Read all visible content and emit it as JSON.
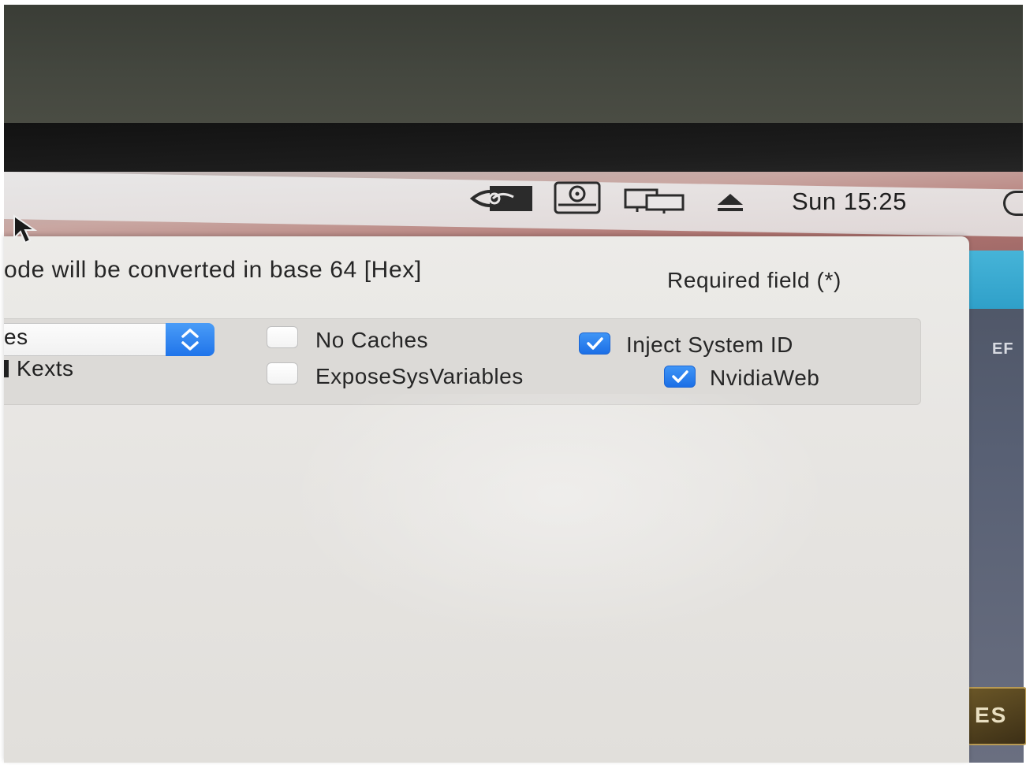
{
  "menubar": {
    "clock": "Sun 15:25",
    "icons": [
      "nvidia-icon",
      "disk-icon",
      "displays-icon",
      "eject-icon"
    ]
  },
  "dialog": {
    "info_text": "ode will be converted in base 64 [Hex]",
    "required_text": "Required field (*)",
    "popup_value": "es",
    "kexts_label": "Kexts",
    "options": [
      {
        "label": "No Caches",
        "checked": false
      },
      {
        "label": "ExposeSysVariables",
        "checked": false
      },
      {
        "label": "Inject System ID",
        "checked": true
      },
      {
        "label": "NvidiaWeb",
        "checked": true
      }
    ]
  },
  "background_window": {
    "label": "EF",
    "badge": "ES"
  },
  "colors": {
    "accent": "#1f74ea",
    "menubar": "#e8e6e6",
    "window": "#e6e4e1"
  }
}
